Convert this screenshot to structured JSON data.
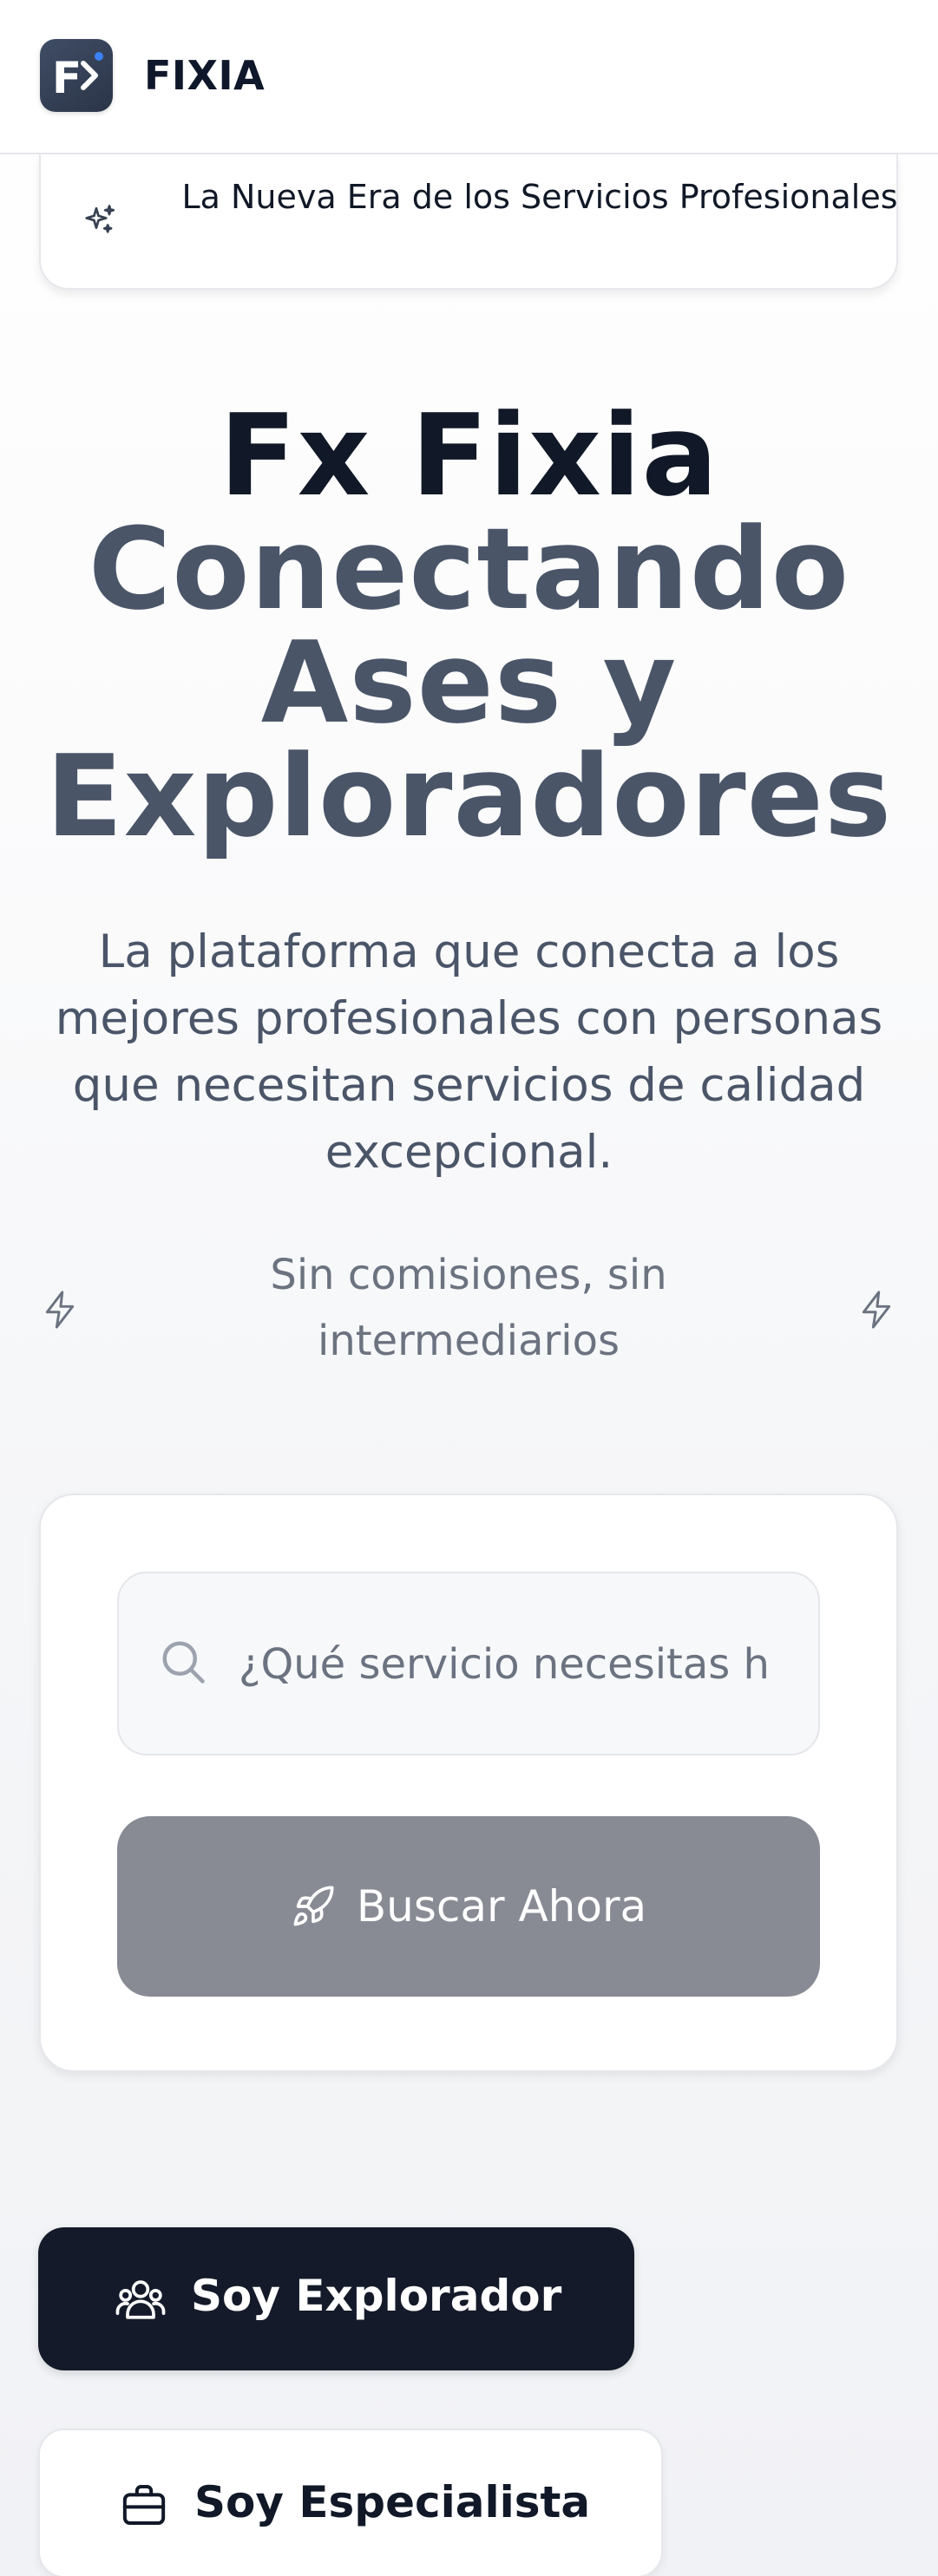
{
  "header": {
    "brand": "FIXIA",
    "logo_letter": "F",
    "logo_colors": {
      "bg": "#3a4660",
      "dot": "#3b82f6"
    }
  },
  "announcement": {
    "text": "La Nueva Era de los Servicios Profesionales",
    "icon": "sparkles-icon"
  },
  "hero": {
    "title_line1": "Fx Fixia",
    "title_line2": "Conectando Ases y Exploradores",
    "subtitle": "La plataforma que conecta a los mejores profesionales con personas que necesitan servicios de calidad excepcional.",
    "note": "Sin comisiones, sin intermediarios",
    "note_icon": "lightning-icon"
  },
  "search": {
    "placeholder": "¿Qué servicio necesitas h",
    "button_label": "Buscar Ahora",
    "button_icon": "rocket-icon",
    "button_color": "#888b94"
  },
  "roles": {
    "explorer_label": "Soy Explorador",
    "explorer_icon": "users-icon",
    "specialist_label": "Soy Especialista",
    "specialist_icon": "briefcase-icon",
    "primary_color": "#141a29"
  }
}
